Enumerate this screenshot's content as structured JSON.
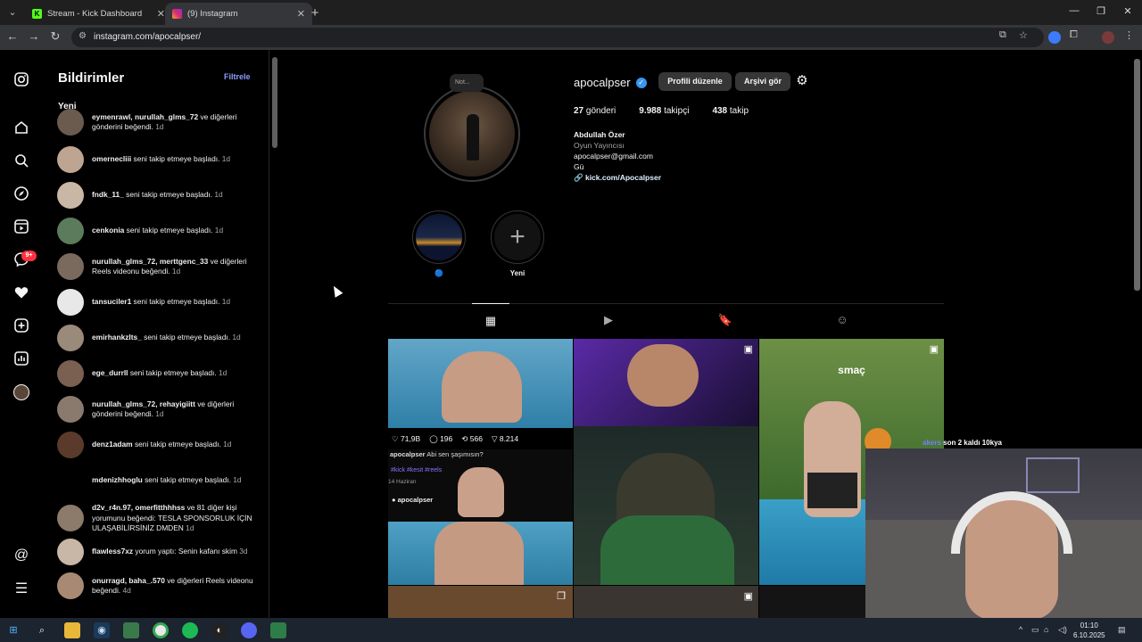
{
  "browser": {
    "tabs": [
      {
        "title": "Stream - Kick Dashboard",
        "icon": "kick-icon",
        "active": false
      },
      {
        "title": "(9) Instagram",
        "icon": "instagram-icon",
        "active": true
      }
    ],
    "url": "instagram.com/apocalpser/"
  },
  "notifications": {
    "heading": "Bildirimler",
    "filter_label": "Filtrele",
    "section_label": "Yeni",
    "items": [
      {
        "user": "eymenrawl, nurullah_glms_72",
        "text": " ve diğerleri gönderini beğendi.",
        "time": " 1d"
      },
      {
        "user": "omernecliii",
        "text": " seni takip etmeye başladı.",
        "time": " 1d"
      },
      {
        "user": "fndk_11_",
        "text": " seni takip etmeye başladı.",
        "time": " 1d"
      },
      {
        "user": "cenkonia",
        "text": " seni takip etmeye başladı.",
        "time": " 1d"
      },
      {
        "user": "nurullah_glms_72, merttgenc_33",
        "text": " ve diğerleri Reels videonu beğendi.",
        "time": " 1d"
      },
      {
        "user": "tansuciler1",
        "text": " seni takip etmeye başladı.",
        "time": " 1d"
      },
      {
        "user": "emirhankzlts_",
        "text": " seni takip etmeye başladı.",
        "time": " 1d"
      },
      {
        "user": "ege_durrll",
        "text": " seni takip etmeye başladı.",
        "time": " 1d"
      },
      {
        "user": "nurullah_glms_72, rehayigiitt",
        "text": " ve diğerleri gönderini beğendi.",
        "time": " 1d"
      },
      {
        "user": "denz1adam",
        "text": " seni takip etmeye başladı.",
        "time": " 1d"
      },
      {
        "user": "mdenizhhoglu",
        "text": " seni takip etmeye başladı.",
        "time": " 1d"
      },
      {
        "user": "d2v_r4n.97, omerfitthhhss",
        "text": " ve 81 diğer kişi yorumunu beğendi: TESLA SPONSORLUK İÇİN ULAŞABİLİRSİNİZ DMDEN",
        "time": " 1d"
      },
      {
        "user": "flawless7xz",
        "text": " yorum yaptı: Senin kafanı skim",
        "time": " 3d"
      },
      {
        "user": "onurragd, baha_.570",
        "text": " ve diğerleri Reels videonu beğendi.",
        "time": " 4d"
      }
    ]
  },
  "profile": {
    "note_label": "Not...",
    "username": "apocalpser",
    "edit_button": "Profili düzenle",
    "archive_button": "Arşivi gör",
    "stats": [
      {
        "value": "27",
        "label": "gönderi"
      },
      {
        "value": "9.988",
        "label": "takipçi"
      },
      {
        "value": "438",
        "label": "takip"
      }
    ],
    "full_name": "Abdullah Özer",
    "category": "Oyun Yayıncısı",
    "email": "apocalpser@gmail.com",
    "bio_line": "Gü",
    "link": "kick.com/Apocalpser",
    "highlights": [
      {
        "label": "🔵"
      },
      {
        "label": "Yeni"
      }
    ],
    "posts": [
      {
        "type": "post",
        "caption_user": "apocalpser",
        "caption": "Abi sen şaşımısın?",
        "tags": "#kick #kesit #reels",
        "date": "14 Haziran",
        "likes": "71,9B",
        "comments": "196",
        "reposts": "566",
        "shares": "8.214",
        "footer_user": "apocalpser"
      },
      {
        "type": "reel"
      },
      {
        "type": "reel",
        "overlay_text": "smaç"
      }
    ]
  },
  "stream_overlay": {
    "name": "akers",
    "text": " son 2 kaldı 10kya"
  },
  "taskbar": {
    "time": "01:10",
    "date": "6.10.2025"
  }
}
